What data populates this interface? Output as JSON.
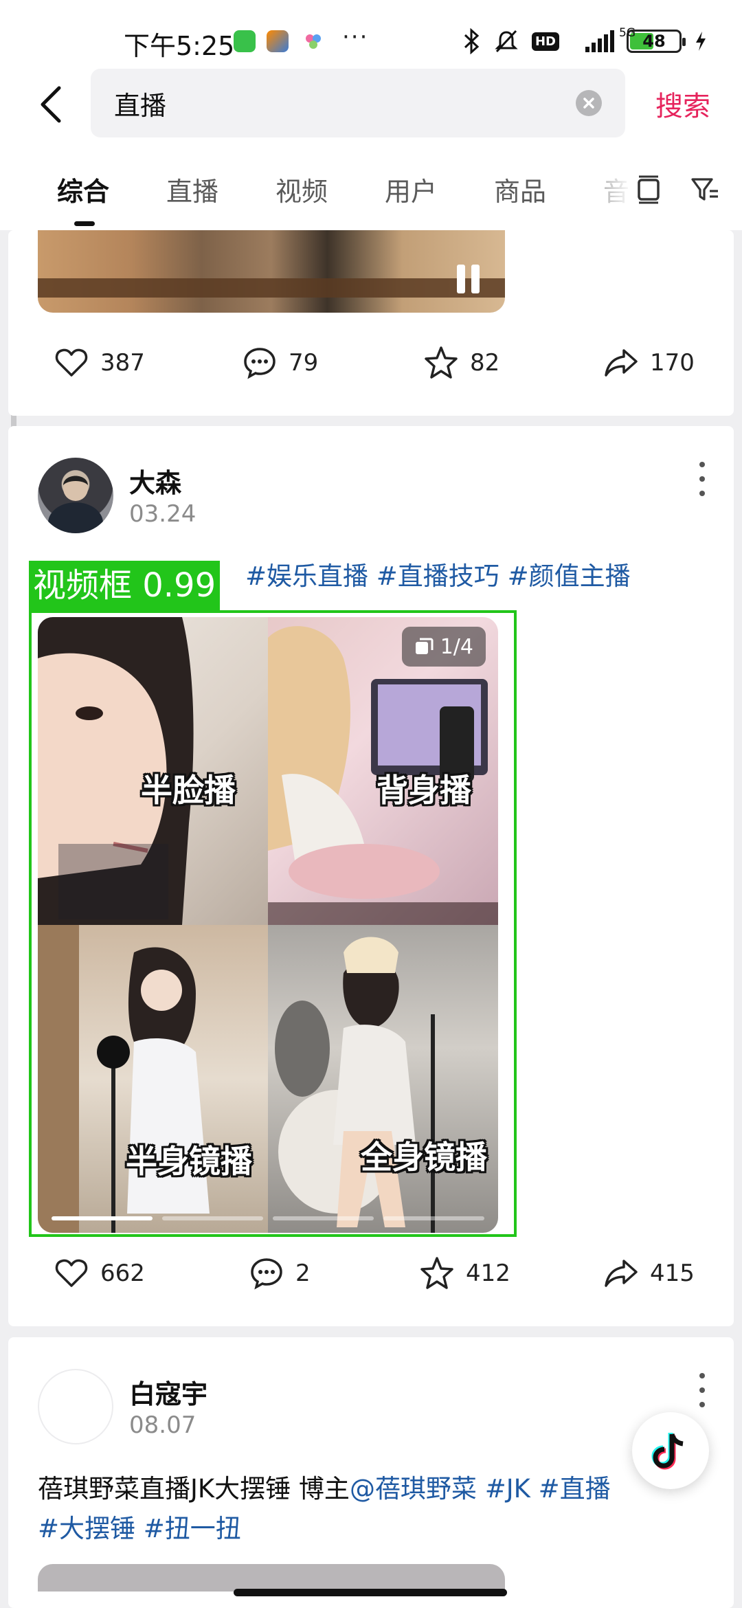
{
  "status_bar": {
    "time": "下午5:25",
    "network": "5G",
    "hd": "HD",
    "battery": "48",
    "more": "···"
  },
  "search": {
    "query": "直播",
    "submit_label": "搜索"
  },
  "tabs": [
    {
      "label": "综合",
      "active": true
    },
    {
      "label": "直播",
      "active": false
    },
    {
      "label": "视频",
      "active": false
    },
    {
      "label": "用户",
      "active": false
    },
    {
      "label": "商品",
      "active": false
    },
    {
      "label": "音",
      "active": false
    }
  ],
  "posts": [
    {
      "stats": {
        "likes": "387",
        "comments": "79",
        "favorites": "82",
        "shares": "170"
      }
    },
    {
      "author": "大森",
      "date": "03.24",
      "hashtags": [
        "#娱乐直播",
        "#直播技巧",
        "#颜值主播"
      ],
      "image_counter": "1/4",
      "detection_label": "视频框 0.99",
      "grid_captions": [
        "半脸播",
        "背身播",
        "半身镜播",
        "全身镜播"
      ],
      "stats": {
        "likes": "662",
        "comments": "2",
        "favorites": "412",
        "shares": "415"
      }
    },
    {
      "author": "白寇宇",
      "date": "08.07",
      "caption_text": "蓓琪野菜直播JK大摆锤 博主",
      "mention": "@蓓琪野菜",
      "hashtags_line1": [
        "#JK",
        "#直播"
      ],
      "hashtags_line2": [
        "#大摆锤",
        "#扭一扭"
      ]
    }
  ],
  "colors": {
    "accent": "#e6235c",
    "hashtag": "#1f5aa3",
    "detection": "#22c51a"
  }
}
